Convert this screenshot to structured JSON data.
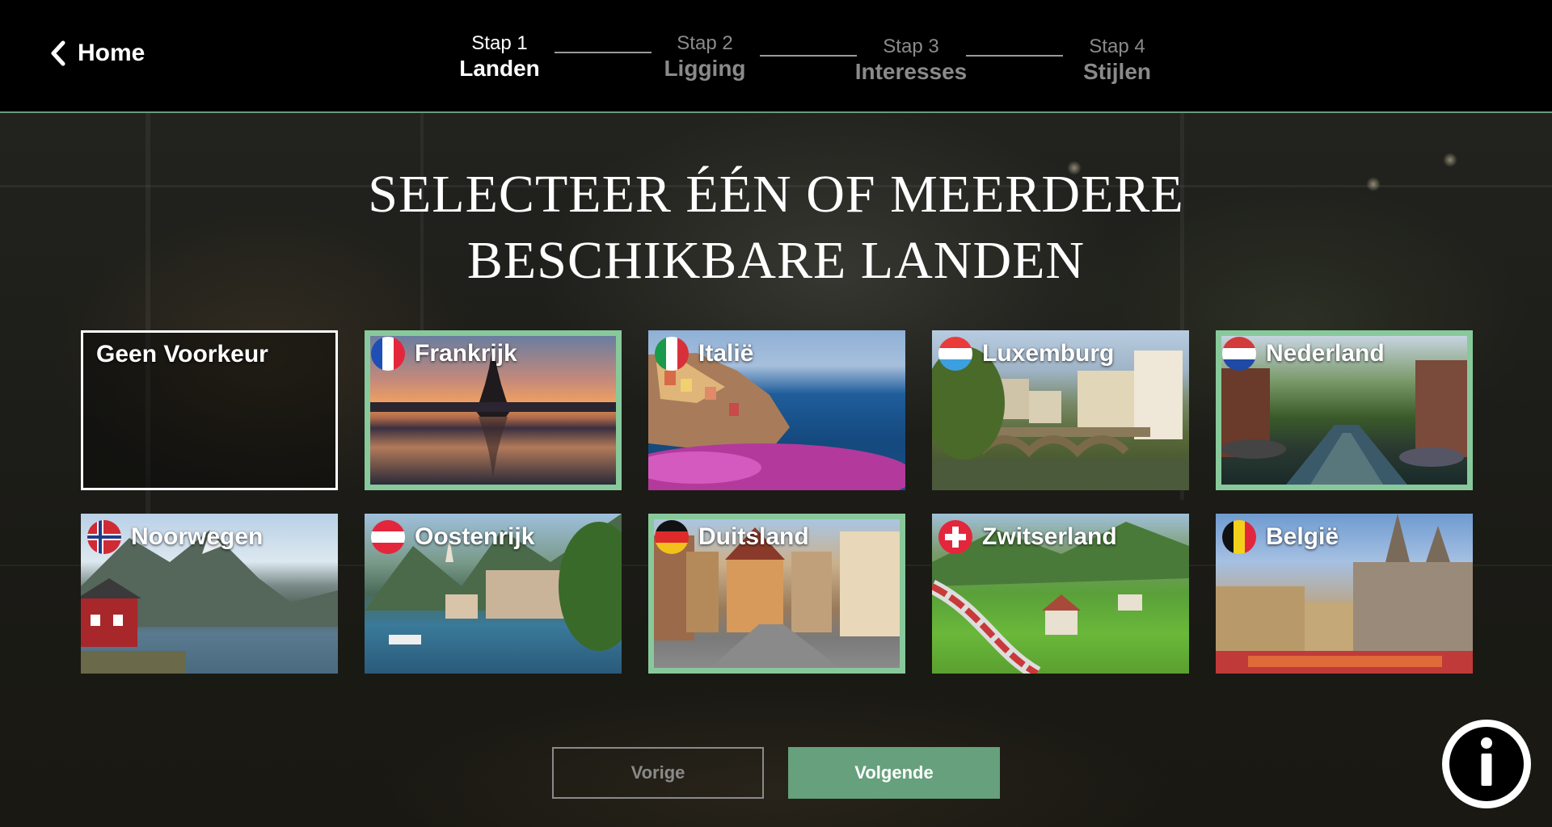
{
  "header": {
    "home_label": "Home",
    "steps": [
      {
        "num": "Stap 1",
        "name": "Landen",
        "active": true
      },
      {
        "num": "Stap 2",
        "name": "Ligging",
        "active": false
      },
      {
        "num": "Stap 3",
        "name": "Interesses",
        "active": false
      },
      {
        "num": "Stap 4",
        "name": "Stijlen",
        "active": false
      }
    ]
  },
  "title": {
    "line1": "SELECTEER ÉÉN OF MEERDERE",
    "line2": "BESCHIKBARE LANDEN"
  },
  "countries": [
    {
      "name": "Geen Voorkeur",
      "selected": false,
      "flag": null
    },
    {
      "name": "Frankrijk",
      "selected": true,
      "flag": "france-flag-icon"
    },
    {
      "name": "Italië",
      "selected": false,
      "flag": "italy-flag-icon"
    },
    {
      "name": "Luxemburg",
      "selected": false,
      "flag": "luxembourg-flag-icon"
    },
    {
      "name": "Nederland",
      "selected": true,
      "flag": "netherlands-flag-icon"
    },
    {
      "name": "Noorwegen",
      "selected": false,
      "flag": "norway-flag-icon"
    },
    {
      "name": "Oostenrijk",
      "selected": false,
      "flag": "austria-flag-icon"
    },
    {
      "name": "Duitsland",
      "selected": true,
      "flag": "germany-flag-icon"
    },
    {
      "name": "Zwitserland",
      "selected": false,
      "flag": "switzerland-flag-icon"
    },
    {
      "name": "België",
      "selected": false,
      "flag": "belgium-flag-icon"
    }
  ],
  "buttons": {
    "prev": "Vorige",
    "next": "Volgende"
  },
  "colors": {
    "accent": "#66a07c",
    "selected_border": "#88c99b"
  },
  "icons": {
    "info": "info-icon",
    "back": "chevron-left-icon"
  }
}
